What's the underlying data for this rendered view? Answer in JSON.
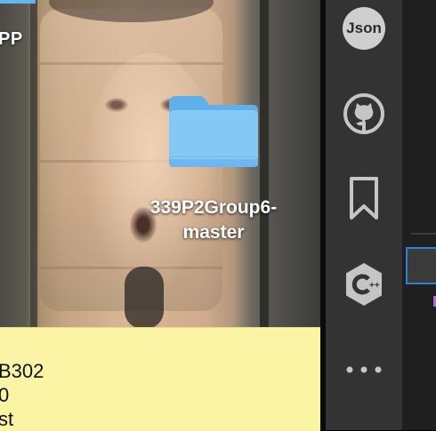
{
  "desktop": {
    "partial_app_label": "PP",
    "folder": {
      "name": "339P2Group6-\nmaster",
      "line1": "339P2Group6-",
      "line2": "master",
      "icon": "folder-icon",
      "color": "#7cc4f4"
    }
  },
  "sticky_note": {
    "lines": [
      "B302",
      "0",
      "st"
    ],
    "color": "#fbf4a5"
  },
  "activity_bar": {
    "items": [
      {
        "name": "json-extension",
        "label": "Json",
        "icon": "json-icon"
      },
      {
        "name": "github",
        "icon": "github-icon"
      },
      {
        "name": "bookmarks",
        "icon": "bookmark-icon"
      },
      {
        "name": "cpp",
        "label": "C++",
        "icon": "cpp-icon"
      },
      {
        "name": "more",
        "icon": "more-horizontal-icon"
      }
    ],
    "background": "#333333",
    "icon_color": "#c5c5c5"
  }
}
